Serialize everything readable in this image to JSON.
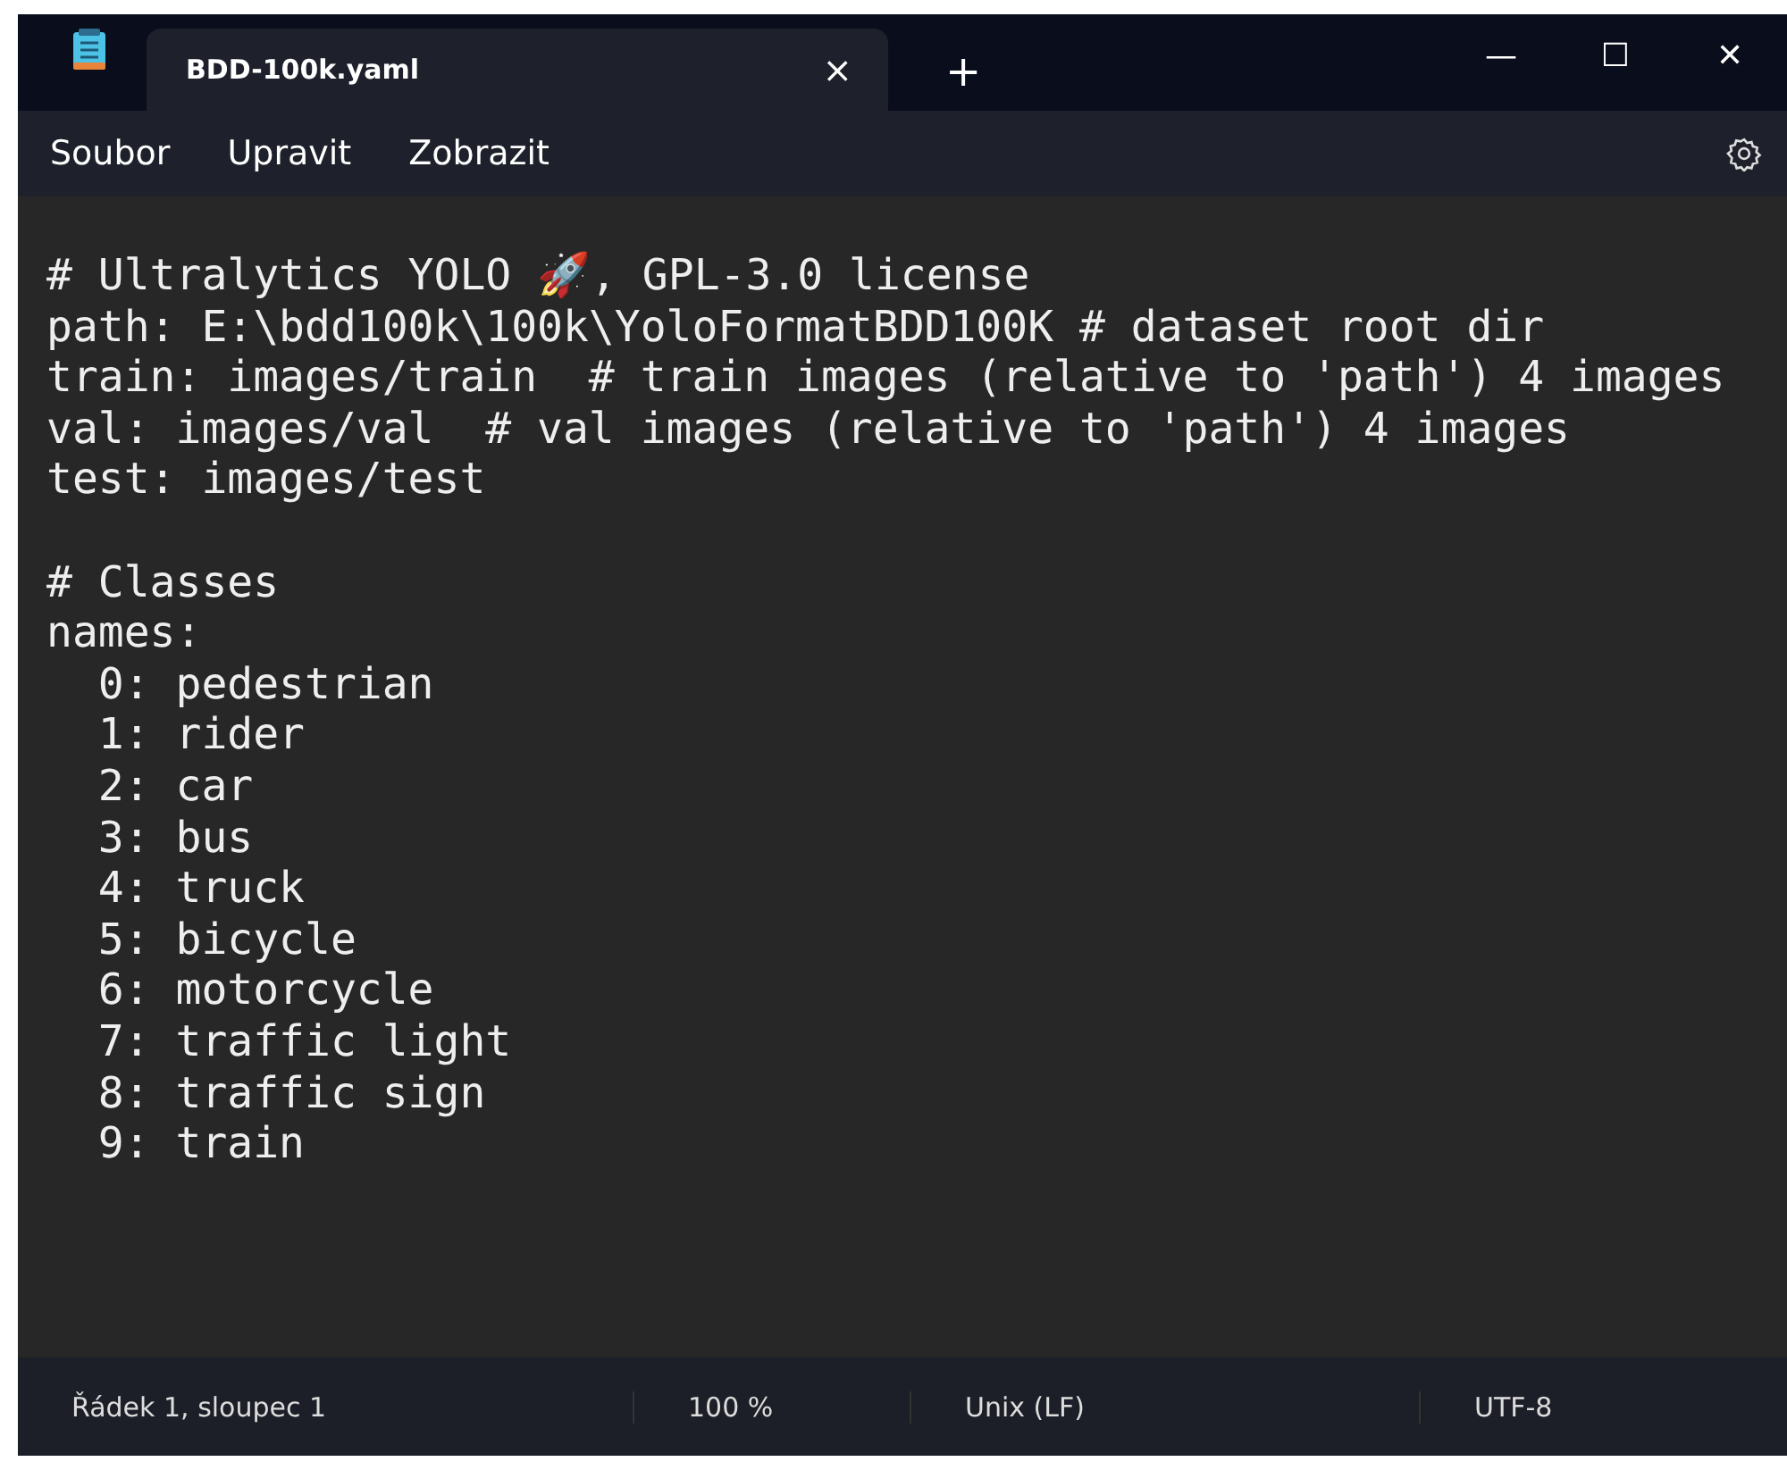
{
  "tabs": [
    {
      "title": "BDD-100k.yaml",
      "selected": true,
      "close": "×"
    }
  ],
  "new_tab": "+",
  "window_controls": {
    "minimize": "—",
    "maximize": "☐",
    "close": "✕"
  },
  "menu": [
    "Soubor",
    "Upravit",
    "Zobrazit"
  ],
  "editor": {
    "blocks": [
      [
        "# Ultralytics YOLO 🚀, GPL-3.0 license",
        "path: E:\\bdd100k\\100k\\YoloFormatBDD100K # dataset root dir",
        "train: images/train  # train images (relative to 'path') 4 images",
        "val: images/val  # val images (relative to 'path') 4 images",
        "test: images/test"
      ],
      [
        "# Classes",
        "names:",
        "  0: pedestrian",
        "  1: rider",
        "  2: car",
        "  3: bus",
        "  4: truck",
        "  5: bicycle",
        "  6: motorcycle",
        "  7: traffic light",
        "  8: traffic sign",
        "  9: train"
      ]
    ]
  },
  "status_bar": [
    {
      "kind": "position",
      "text": "Řádek 1, sloupec 1"
    },
    {
      "kind": "zoom",
      "text": "100 %"
    },
    {
      "kind": "line_ending",
      "text": "Unix (LF)"
    },
    {
      "kind": "encoding",
      "text": "UTF-8"
    }
  ]
}
